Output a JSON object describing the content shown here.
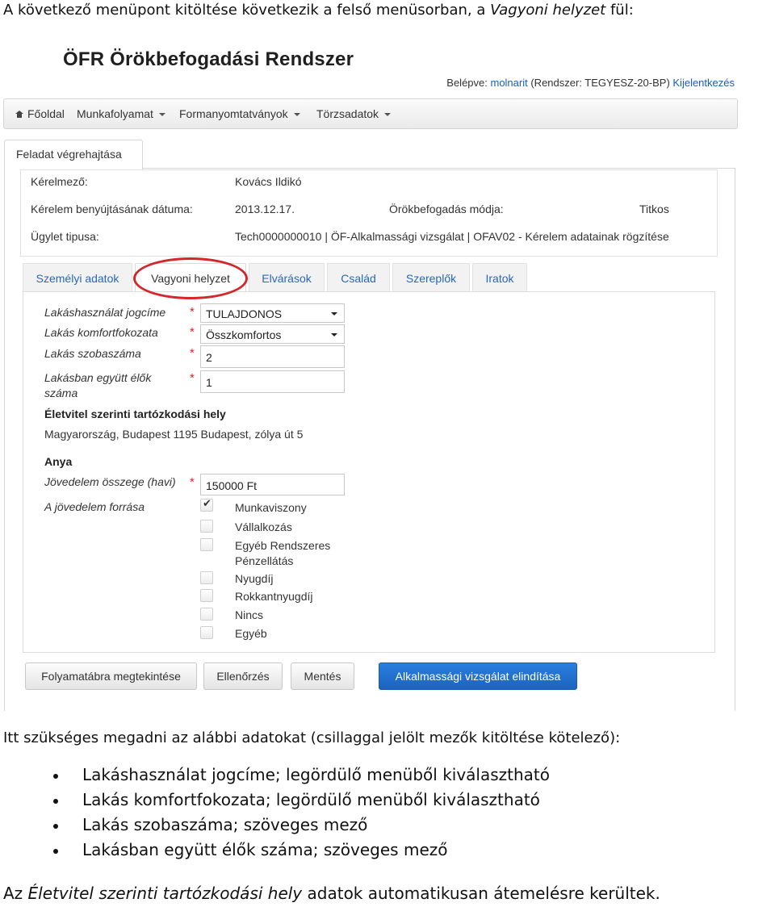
{
  "doc": {
    "intro_before": "A következő menüpont kitöltése következik a felső menüsorban, a ",
    "intro_italic": "Vagyoni helyzet",
    "intro_after": " fül:",
    "paragraph": "Itt szükséges megadni az alábbi adatokat (csillaggal jelölt mezők kitöltése kötelező):",
    "bullets": [
      "Lakáshasználat jogcíme; legördülő menüből kiválasztható",
      "Lakás komfortfokozata; legördülő menüből kiválasztható",
      "Lakás szobaszáma; szöveges mező",
      "Lakásban együtt élők száma; szöveges mező"
    ],
    "outro_before": "Az ",
    "outro_italic": "Életvitel szerinti tartózkodási hely",
    "outro_after": " adatok automatikusan átemelésre kerültek."
  },
  "app": {
    "title": "ÖFR Örökbefogadási Rendszer",
    "user_prefix": "Belépve: ",
    "user": "molnarit",
    "system_prefix": " (Rendszer: TEGYESZ-20-BP) ",
    "logout": "Kijelentkezés"
  },
  "nav": {
    "home": "Főoldal",
    "items": [
      "Munkafolyamat",
      "Formanyomtatványok",
      "Törzsadatok"
    ]
  },
  "outer_tab": "Feladat végrehajtása",
  "info": {
    "applicant_label": "Kérelmező:",
    "applicant_value": "Kovács Ildikó",
    "date_label": "Kérelem benyújtásának dátuma:",
    "date_value": "2013.12.17.",
    "mode_label": "Örökbefogadás módja:",
    "mode_value": "Titkos",
    "type_label": "Ügylet tipusa:",
    "type_value": "Tech0000000010 | ÖF-Alkalmassági vizsgálat | OFAV02 - Kérelem adatainak rögzítése"
  },
  "tabs": [
    "Személyi adatok",
    "Vagyoni helyzet",
    "Elvárások",
    "Család",
    "Szereplők",
    "Iratok"
  ],
  "form": {
    "housing_label": "Lakáshasználat jogcíme",
    "housing_value": "TULAJDONOS",
    "comfort_label": "Lakás komfortfokozata",
    "comfort_value": "Összkomfortos",
    "rooms_label": "Lakás szobaszáma",
    "rooms_value": "2",
    "residents_label": "Lakásban együtt élők száma",
    "residents_value": "1",
    "residence_heading": "Életvitel szerinti tartózkodási hely",
    "residence_value": "Magyarország, Budapest 1195 Budapest, zólya út 5",
    "mother_heading": "Anya",
    "income_label": "Jövedelem összege (havi)",
    "income_value": "150000 Ft",
    "source_label": "A jövedelem forrása",
    "required_mark": "*",
    "sources": [
      {
        "label": "Munkaviszony",
        "checked": true
      },
      {
        "label": "Vállalkozás",
        "checked": false
      },
      {
        "label": "Egyéb Rendszeres Pénzellátás",
        "checked": false
      },
      {
        "label": "Nyugdíj",
        "checked": false
      },
      {
        "label": "Rokkantnyugdíj",
        "checked": false
      },
      {
        "label": "Nincs",
        "checked": false
      },
      {
        "label": "Egyéb",
        "checked": false
      }
    ]
  },
  "buttons": {
    "flowchart": "Folyamatábra megtekintése",
    "check": "Ellenőrzés",
    "save": "Mentés",
    "start": "Alkalmassági vizsgálat elindítása"
  },
  "colors": {
    "link": "#1a5eb7",
    "primary": "#1b63bf",
    "highlight_circle": "#d4262b",
    "required": "#d9242a"
  }
}
